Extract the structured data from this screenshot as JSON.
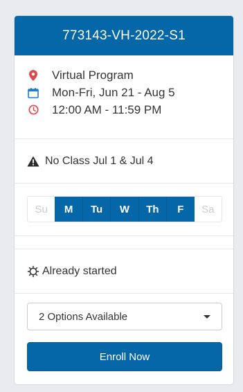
{
  "course": {
    "code": "773143-VH-2022-S1"
  },
  "details": {
    "location": "Virtual Program",
    "dates": "Mon-Fri, Jun 21 - Aug 5",
    "time": "12:00 AM - 11:59 PM"
  },
  "notice": {
    "text": "No Class Jul 1 & Jul 4",
    "icon": "warning-icon"
  },
  "days": [
    {
      "label": "Su",
      "active": false
    },
    {
      "label": "M",
      "active": true
    },
    {
      "label": "Tu",
      "active": true
    },
    {
      "label": "W",
      "active": true
    },
    {
      "label": "Th",
      "active": true
    },
    {
      "label": "F",
      "active": true
    },
    {
      "label": "Sa",
      "active": false
    }
  ],
  "status": {
    "text": "Already started",
    "icon": "gear-icon"
  },
  "options": {
    "selected": "2 Options Available"
  },
  "enroll": {
    "label": "Enroll Now"
  },
  "colors": {
    "brand": "#0567a8",
    "location_icon": "#e0474c",
    "calendar_icon": "#1f7fc1",
    "clock_icon": "#e0474c"
  }
}
